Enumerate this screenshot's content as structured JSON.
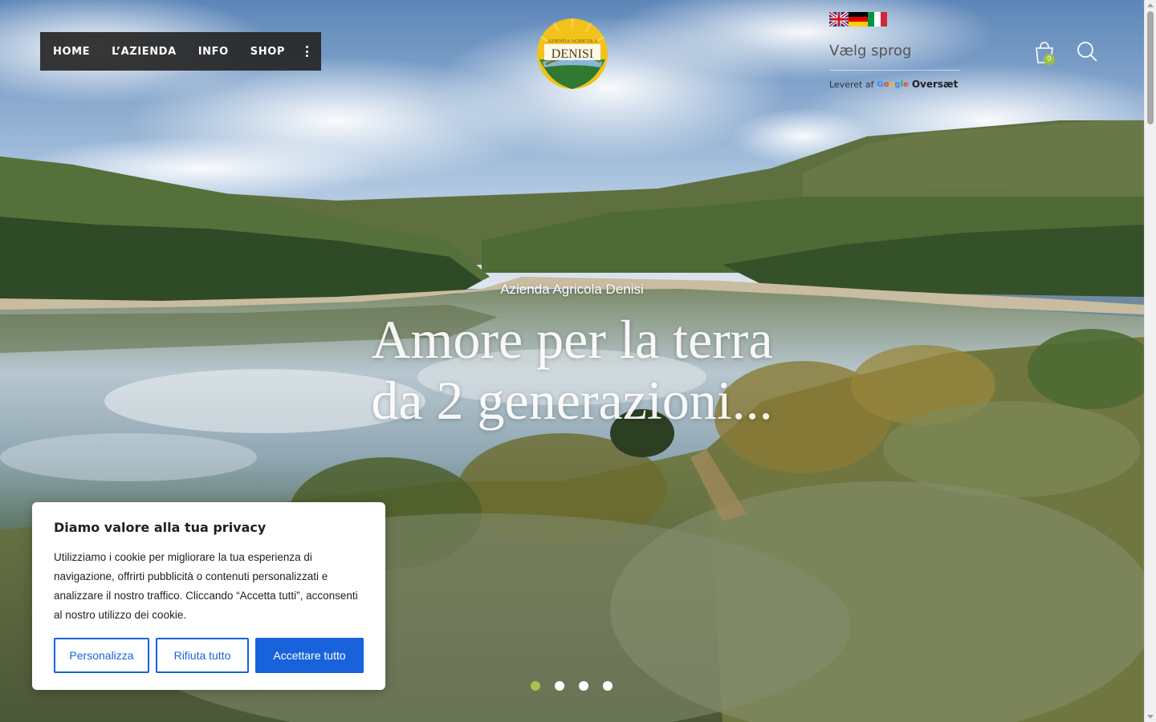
{
  "nav": {
    "items": [
      "HOME",
      "L’AZIENDA",
      "INFO",
      "SHOP"
    ],
    "more_icon": "vertical-dots-icon"
  },
  "logo": {
    "top_text": "AZIENDA AGRICOLA",
    "name": "DENISI"
  },
  "language": {
    "flags": [
      "english-flag-icon",
      "german-flag-icon",
      "italian-flag-icon"
    ],
    "select_label": "Vælg sprog",
    "powered_by": "Leveret af",
    "google": "Google",
    "translate": "Oversæt"
  },
  "cart": {
    "icon": "shopping-bag-icon",
    "count": "0",
    "badge_color": "#9bbf3f"
  },
  "search": {
    "icon": "search-icon"
  },
  "hero": {
    "subtitle": "Azienda Agricola Denisi",
    "title_line1": "Amore per la terra",
    "title_line2": "da 2 generazioni...",
    "slides": 4,
    "active_slide": 1,
    "active_dot_color": "#a9c24b"
  },
  "cookie": {
    "title": "Diamo valore alla tua privacy",
    "text": "Utilizziamo i cookie per migliorare la tua esperienza di navigazione, offrirti pubblicità o contenuti personalizzati e analizzare il nostro traffico. Cliccando “Accetta tutti”, acconsenti al nostro utilizzo dei cookie.",
    "btn_customize": "Personalizza",
    "btn_reject": "Rifiuta tutto",
    "btn_accept": "Accettare tutto",
    "accent_color": "#1863dc"
  }
}
